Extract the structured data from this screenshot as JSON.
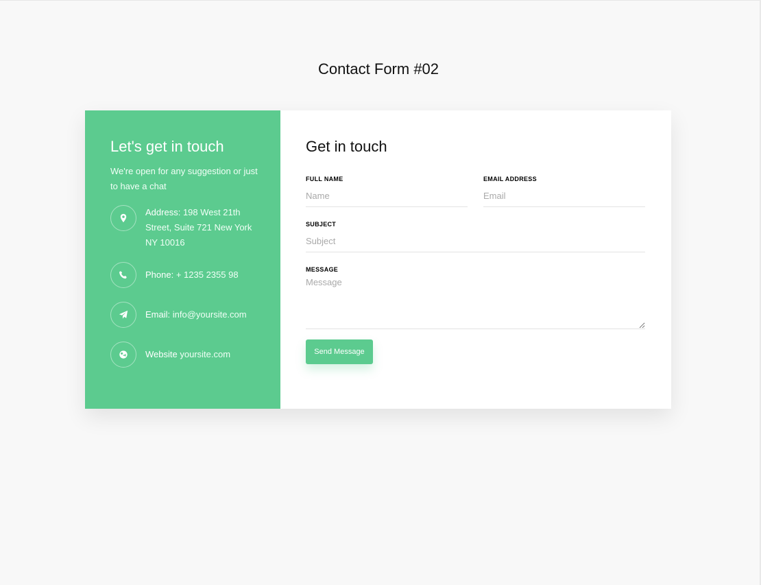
{
  "page": {
    "title": "Contact Form #02"
  },
  "colors": {
    "accent": "#5ccb8f",
    "background": "#f8f8f8"
  },
  "info": {
    "title": "Let's get in touch",
    "subtitle": "We're open for any suggestion or just to have a chat",
    "items": [
      {
        "icon": "map-marker-icon",
        "label": "Address:",
        "value": "198 West 21th Street, Suite 721 New York NY 10016"
      },
      {
        "icon": "phone-icon",
        "label": "Phone:",
        "value": "+ 1235 2355 98"
      },
      {
        "icon": "paper-plane-icon",
        "label": "Email:",
        "value": "info@yoursite.com"
      },
      {
        "icon": "globe-icon",
        "label": "Website",
        "value": "yoursite.com"
      }
    ]
  },
  "form": {
    "title": "Get in touch",
    "fields": {
      "name": {
        "label": "FULL NAME",
        "placeholder": "Name",
        "value": ""
      },
      "email": {
        "label": "EMAIL ADDRESS",
        "placeholder": "Email",
        "value": ""
      },
      "subject": {
        "label": "SUBJECT",
        "placeholder": "Subject",
        "value": ""
      },
      "message": {
        "label": "MESSAGE",
        "placeholder": "Message",
        "value": ""
      }
    },
    "submit_label": "Send Message"
  }
}
